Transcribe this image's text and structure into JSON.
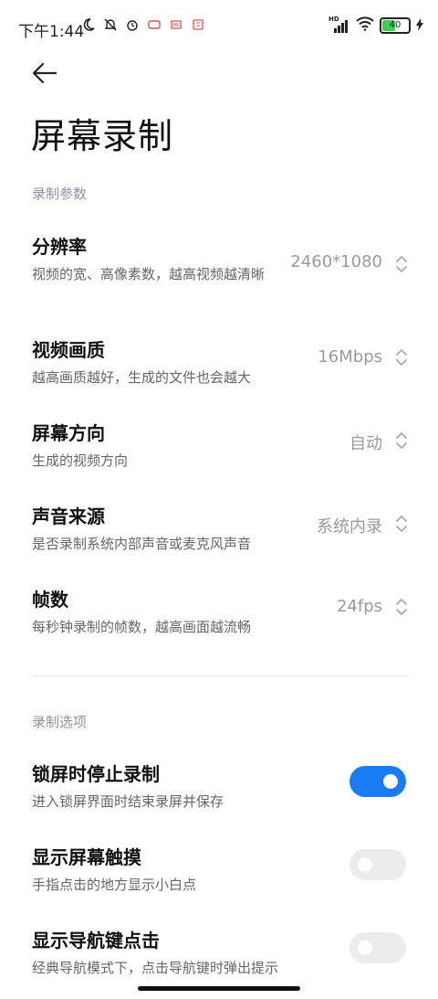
{
  "status_bar": {
    "time": "下午1:44",
    "battery_level": "40",
    "network_badge": "HD"
  },
  "page": {
    "title": "屏幕录制",
    "back_icon": "back-arrow-icon"
  },
  "sections": [
    {
      "label": "录制参数",
      "items": [
        {
          "title": "分辨率",
          "desc": "视频的宽、高像素数，越高视频越清晰",
          "value": "2460*1080"
        },
        {
          "title": "视频画质",
          "desc": "越高画质越好，生成的文件也会越大",
          "value": "16Mbps"
        },
        {
          "title": "屏幕方向",
          "desc": "生成的视频方向",
          "value": "自动"
        },
        {
          "title": "声音来源",
          "desc": "是否录制系统内部声音或麦克风声音",
          "value": "系统内录"
        },
        {
          "title": "帧数",
          "desc": "每秒钟录制的帧数，越高画面越流畅",
          "value": "24fps"
        }
      ]
    },
    {
      "label": "录制选项",
      "items": [
        {
          "title": "锁屏时停止录制",
          "desc": "进入锁屏界面时结束录屏并保存",
          "enabled": true
        },
        {
          "title": "显示屏幕触摸",
          "desc": "手指点击的地方显示小白点",
          "enabled": false
        },
        {
          "title": "显示导航键点击",
          "desc": "经典导航模式下，点击导航键时弹出提示",
          "enabled": false
        }
      ]
    }
  ],
  "colors": {
    "accent": "#1a7cf2",
    "section_label": "#8a94a6",
    "value_text": "#9a9a9a"
  }
}
